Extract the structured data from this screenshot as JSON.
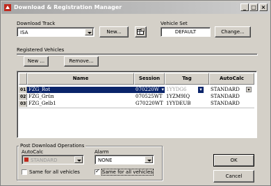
{
  "window": {
    "title": "Download & Registration Manager"
  },
  "titlebar_buttons": {
    "minimize": "_",
    "maximize": "□",
    "close": "×"
  },
  "download_track": {
    "label": "Download Track",
    "value": "ISA",
    "new_button": "New..."
  },
  "vehicle_set": {
    "label": "Vehicle Set",
    "value": "DEFAULT",
    "change_button": "Change..."
  },
  "registered_vehicles": {
    "label": "Registered Vehicles",
    "new_button": "New ...",
    "remove_button": "Remove..."
  },
  "table": {
    "columns": [
      "Name",
      "Session",
      "Tag",
      "AutoCalc"
    ],
    "rows": [
      {
        "num": "01",
        "name": "FZG_Rot",
        "session": "070220W",
        "tag": "1YYDG6",
        "autocalc": "STANDARD",
        "selected": true
      },
      {
        "num": "02",
        "name": "FZG_Grün",
        "session": "070525WT",
        "tag": "1YZM9IQ",
        "autocalc": "STANDARD",
        "selected": false
      },
      {
        "num": "03",
        "name": "FZG_Gelb1",
        "session": "G70220WT",
        "tag": "1YYDEUB",
        "autocalc": "STANDARD",
        "selected": false
      }
    ]
  },
  "post_download": {
    "label": "Post Download Operations",
    "autocalc_label": "AutoCalc",
    "autocalc_value": "STANDARD",
    "alarm_label": "Alarm",
    "alarm_value": "NONE",
    "same_for_all_1": "Same for all vehicles",
    "same_for_all_2": "Same for all vehicles",
    "same_for_all_1_checked": false,
    "same_for_all_2_checked": true
  },
  "buttons": {
    "ok": "OK",
    "cancel": "Cancel"
  },
  "colors": {
    "selection": "#0a246a",
    "title_gradient": "#a6a6a6",
    "title_icon": "#c0281c"
  },
  "icons": {
    "title": "app-red-icon",
    "browse": "folder-grid-icon"
  }
}
